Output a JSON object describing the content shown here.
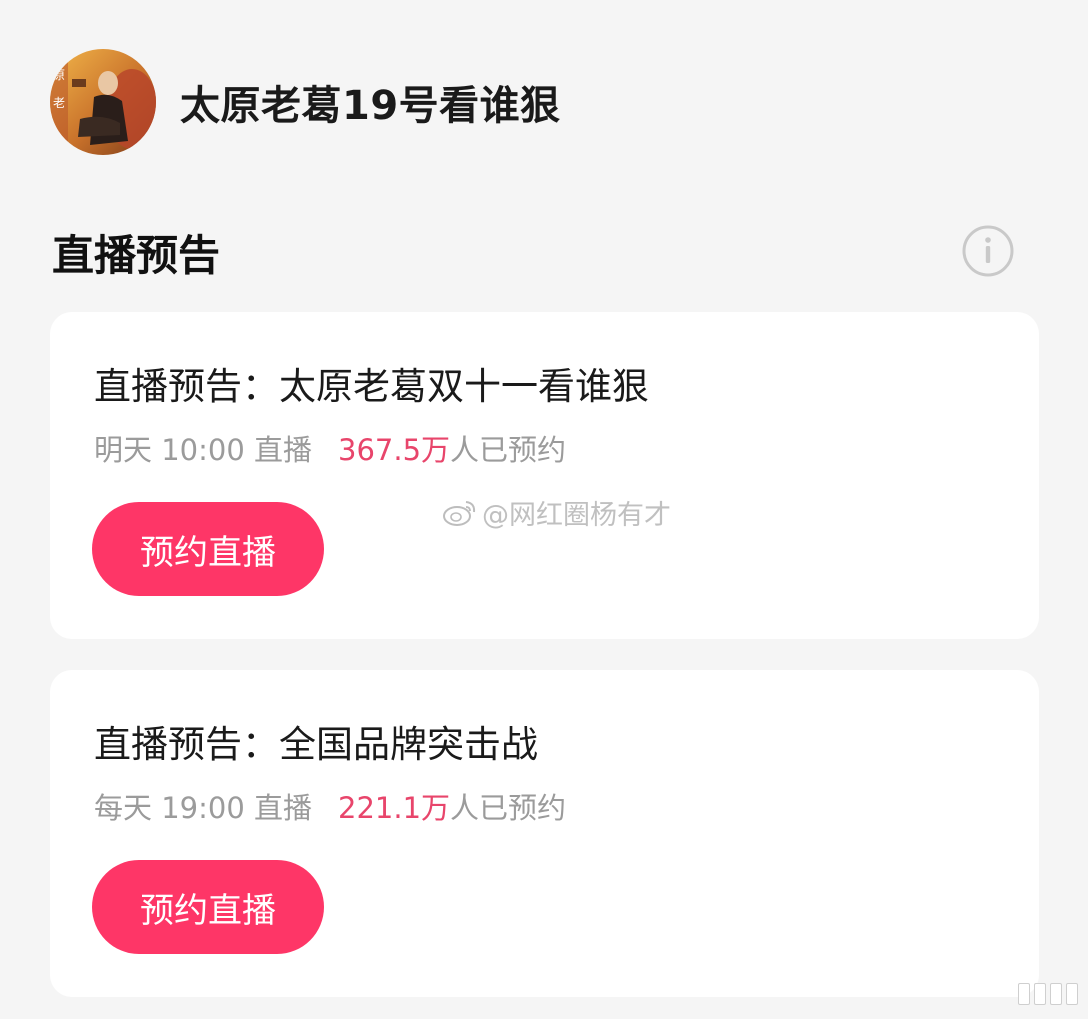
{
  "profile": {
    "name": "太原老葛19号看谁狠",
    "avatar_text_top": "原",
    "avatar_text_bottom": "老"
  },
  "section": {
    "title": "直播预告",
    "info_icon": "info-circle-icon"
  },
  "cards": [
    {
      "title": "直播预告：太原老葛双十一看谁狠",
      "schedule": "明天 10:00 直播",
      "count": "367.5万",
      "count_suffix": "人已预约",
      "button_label": "预约直播"
    },
    {
      "title": "直播预告：全国品牌突击战",
      "schedule": "每天 19:00 直播",
      "count": "221.1万",
      "count_suffix": "人已预约",
      "button_label": "预约直播"
    }
  ],
  "watermark": {
    "text": "@网红圈杨有才",
    "icon": "weibo-icon"
  },
  "colors": {
    "background": "#f5f5f5",
    "card": "#ffffff",
    "accent_button": "#fe3667",
    "count_text": "#e8456b",
    "meta_text": "#9b9b9b"
  }
}
